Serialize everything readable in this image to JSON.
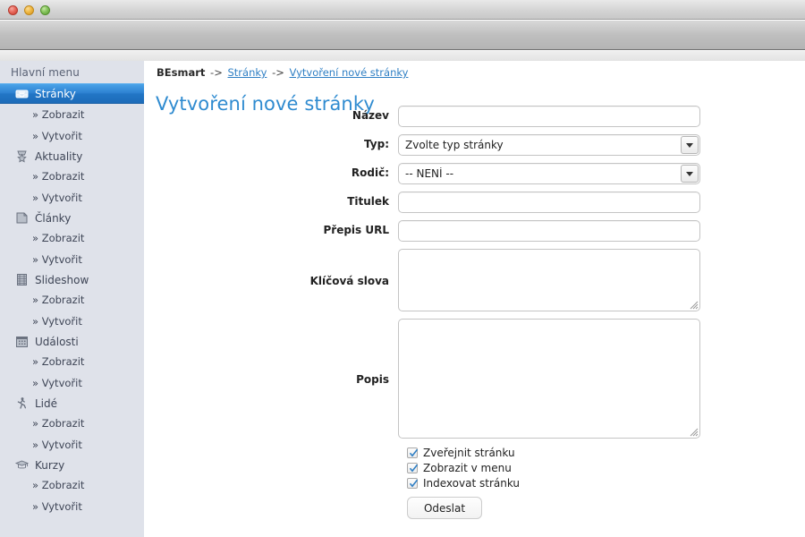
{
  "window": {
    "traffic_lights": [
      "close",
      "minimize",
      "maximize"
    ]
  },
  "sidebar": {
    "heading": "Hlavní menu",
    "groups": [
      {
        "icon": "inbox-tray-icon",
        "label": "Stránky",
        "selected": true,
        "children": [
          {
            "label": "» Zobrazit"
          },
          {
            "label": "» Vytvořit"
          }
        ]
      },
      {
        "icon": "star-medal-icon",
        "label": "Aktuality",
        "selected": false,
        "children": [
          {
            "label": "» Zobrazit"
          },
          {
            "label": "» Vytvořit"
          }
        ]
      },
      {
        "icon": "document-page-icon",
        "label": "Články",
        "selected": false,
        "children": [
          {
            "label": "» Zobrazit"
          },
          {
            "label": "» Vytvořit"
          }
        ]
      },
      {
        "icon": "filmstrip-icon",
        "label": "Slideshow",
        "selected": false,
        "children": [
          {
            "label": "» Zobrazit"
          },
          {
            "label": "» Vytvořit"
          }
        ]
      },
      {
        "icon": "calendar-icon",
        "label": "Události",
        "selected": false,
        "children": [
          {
            "label": "» Zobrazit"
          },
          {
            "label": "» Vytvořit"
          }
        ]
      },
      {
        "icon": "person-walking-icon",
        "label": "Lidé",
        "selected": false,
        "children": [
          {
            "label": "» Zobrazit"
          },
          {
            "label": "» Vytvořit"
          }
        ]
      },
      {
        "icon": "graduation-cap-icon",
        "label": "Kurzy",
        "selected": false,
        "children": [
          {
            "label": "» Zobrazit"
          },
          {
            "label": "» Vytvořit"
          }
        ]
      }
    ]
  },
  "breadcrumb": {
    "root": "BEsmart",
    "sep": "->",
    "link1": "Stránky",
    "link2": "Vytvoření nové stránky"
  },
  "page_title": "Vytvoření nové stránky",
  "form": {
    "fields": {
      "nazev": {
        "label": "Název",
        "value": "",
        "placeholder": ""
      },
      "typ": {
        "label": "Typ:",
        "value": "Zvolte typ stránky"
      },
      "rodic": {
        "label": "Rodič:",
        "value": "-- NENÍ --"
      },
      "titulek": {
        "label": "Titulek",
        "value": "",
        "placeholder": ""
      },
      "url": {
        "label": "Přepis URL",
        "value": "",
        "placeholder": ""
      },
      "klicova": {
        "label": "Klíčová slova",
        "value": ""
      },
      "popis": {
        "label": "Popis",
        "value": ""
      }
    },
    "checkboxes": [
      {
        "label": "Zveřejnit stránku",
        "checked": true
      },
      {
        "label": "Zobrazit v menu",
        "checked": true
      },
      {
        "label": "Indexovat stránku",
        "checked": true
      }
    ],
    "submit_label": "Odeslat"
  },
  "colors": {
    "sidebar_bg": "#dfe2ea",
    "selected_blue": "#2b7fd0",
    "title_blue": "#2f8bd0",
    "link_blue": "#2f7fc4",
    "checkbox_check": "#2f7fc4"
  }
}
